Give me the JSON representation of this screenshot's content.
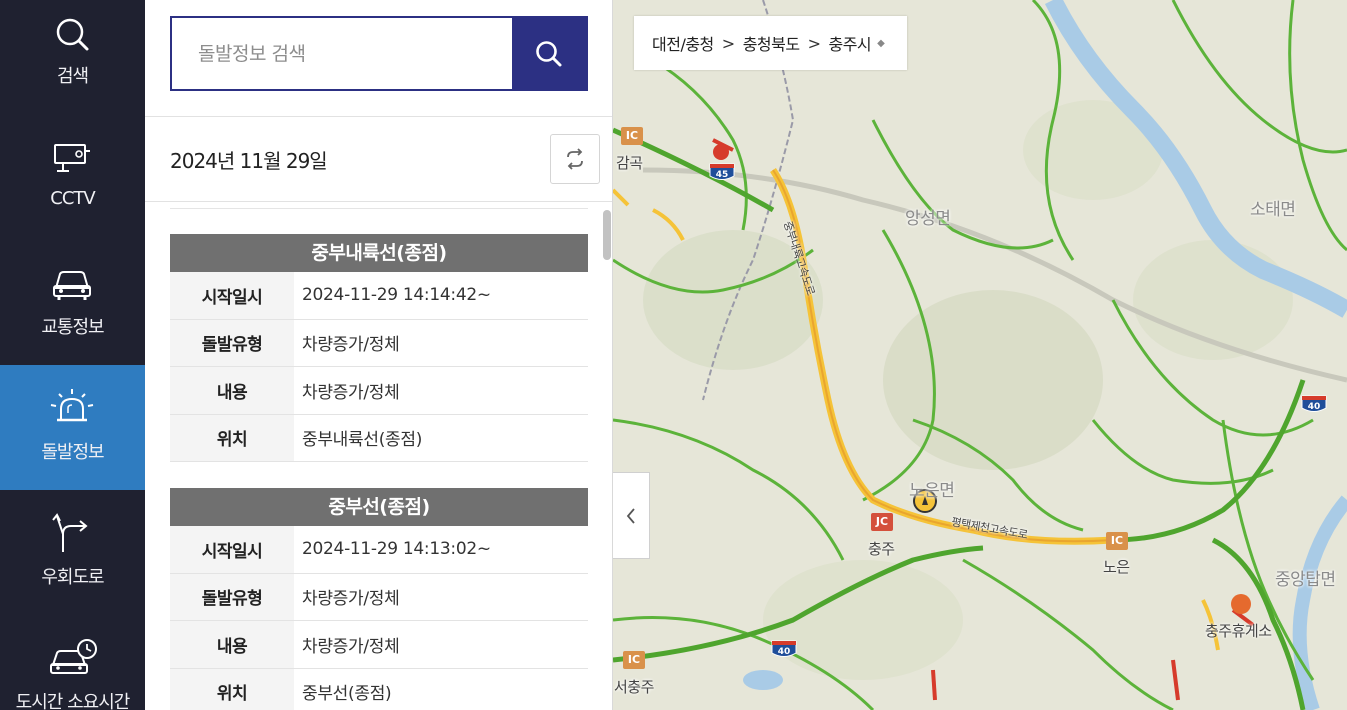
{
  "nav": {
    "items": [
      {
        "label": "검색",
        "icon": "search-icon"
      },
      {
        "label": "CCTV",
        "icon": "cctv-icon"
      },
      {
        "label": "교통정보",
        "icon": "car-icon"
      },
      {
        "label": "돌발정보",
        "icon": "alert-siren-icon",
        "active": true
      },
      {
        "label": "우회도로",
        "icon": "detour-arrow-icon"
      },
      {
        "label": "도시간 소요시간",
        "icon": "car-clock-icon"
      }
    ]
  },
  "search": {
    "placeholder": "돌발정보 검색"
  },
  "date": "2024년 11월 29일",
  "field_labels": {
    "start": "시작일시",
    "type": "돌발유형",
    "content": "내용",
    "location": "위치"
  },
  "incidents": [
    {
      "title": "중부내륙선(종점)",
      "start": "2024-11-29  14:14:42~",
      "type": "차량증가/정체",
      "content": "차량증가/정체",
      "location": "중부내륙선(종점)"
    },
    {
      "title": "중부선(종점)",
      "start": "2024-11-29  14:13:02~",
      "type": "차량증가/정체",
      "content": "차량증가/정체",
      "location": "중부선(종점)"
    }
  ],
  "map": {
    "breadcrumb": [
      "대전/충청",
      "충청북도",
      "충주시"
    ],
    "breadcrumb_sep": ">",
    "labels": {
      "gamgok": "감곡",
      "angseong": "앙성면",
      "sotae": "소태면",
      "noeun_myeon": "노은면",
      "chungju": "충주",
      "noeun": "노은",
      "jungang_tap": "중앙탑면",
      "rest_area": "충주휴게소",
      "seochungju": "서충주",
      "expressway": "평택제천고속도로",
      "jungbu_naeryuk": "중부내륙고속도로"
    },
    "badges": {
      "ic": "IC",
      "jc": "JC"
    },
    "route_numbers": {
      "r45": "45",
      "r40a": "40",
      "r40b": "40"
    },
    "colors": {
      "road_green": "#5cb33a",
      "highway_yellow": "#f5c338",
      "congested_red": "#d63b2b",
      "water": "#a9cbe6"
    }
  }
}
